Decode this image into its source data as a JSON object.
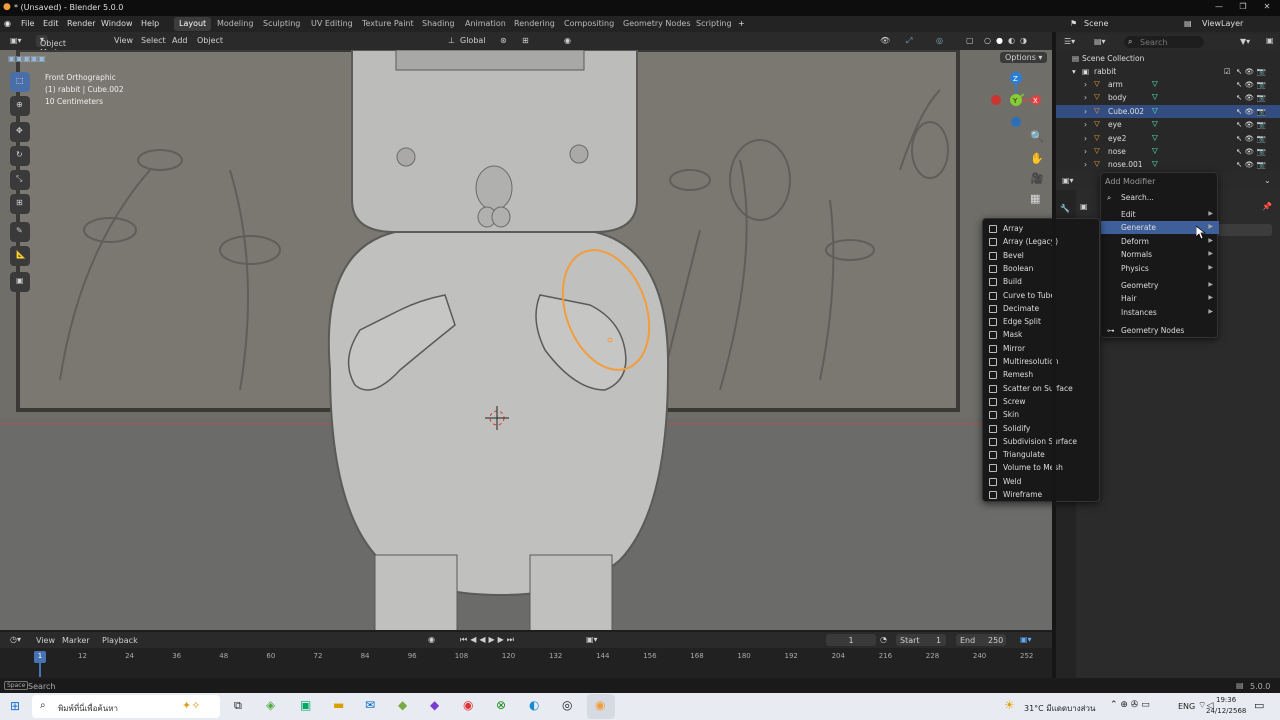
{
  "window": {
    "title": "* (Unsaved) - Blender 5.0.0"
  },
  "menubar": {
    "items": [
      "File",
      "Edit",
      "Render",
      "Window",
      "Help"
    ],
    "workspaces": [
      "Layout",
      "Modeling",
      "Sculpting",
      "UV Editing",
      "Texture Paint",
      "Shading",
      "Animation",
      "Rendering",
      "Compositing",
      "Geometry Nodes",
      "Scripting"
    ],
    "active_workspace": "Layout",
    "add_tab": "+",
    "scene_label": "Scene",
    "view_layer_label": "ViewLayer"
  },
  "viewport_header": {
    "mode": "Object Mode",
    "menus": [
      "View",
      "Select",
      "Add",
      "Object"
    ],
    "transform_orientation": "Global",
    "options": "Options"
  },
  "viewport_overlay": {
    "view_name": "Front Orthographic",
    "object_info": "(1) rabbit | Cube.002",
    "scale_info": "10 Centimeters"
  },
  "gizmo": {
    "x": "X",
    "y": "Y",
    "z": "Z"
  },
  "outliner": {
    "search_placeholder": "Search",
    "root": "Scene Collection",
    "collection": "rabbit",
    "objects": [
      "arm",
      "body",
      "Cube.002",
      "eye",
      "eye2",
      "nose",
      "nose.001"
    ],
    "selected": "Cube.002"
  },
  "add_modifier_menu": {
    "title": "Add Modifier",
    "search": "Search...",
    "categories": [
      "Edit",
      "Generate",
      "Deform",
      "Normals",
      "Physics"
    ],
    "categories2": [
      "Geometry",
      "Hair",
      "Instances"
    ],
    "geometry_nodes": "Geometry Nodes",
    "highlighted": "Generate"
  },
  "generate_submenu": {
    "items": [
      "Array",
      "Array (Legacy)",
      "Bevel",
      "Boolean",
      "Build",
      "Curve to Tube",
      "Decimate",
      "Edge Split",
      "Mask",
      "Mirror",
      "Multiresolution",
      "Remesh",
      "Scatter on Surface",
      "Screw",
      "Skin",
      "Solidify",
      "Subdivision Surface",
      "Triangulate",
      "Volume to Mesh",
      "Weld",
      "Wireframe"
    ]
  },
  "timeline": {
    "menus": [
      "View",
      "Marker",
      "Playback"
    ],
    "current_frame": "1",
    "start_label": "Start",
    "start": "1",
    "end_label": "End",
    "end": "250",
    "ticks": [
      "12",
      "24",
      "36",
      "48",
      "60",
      "72",
      "84",
      "96",
      "108",
      "120",
      "132",
      "144",
      "156",
      "168",
      "180",
      "192",
      "204",
      "216",
      "228",
      "240",
      "252"
    ],
    "playhead": "1"
  },
  "statusbar": {
    "key": "Space",
    "action": "Search",
    "version": "5.0.0"
  },
  "taskbar": {
    "search_placeholder": "พิมพ์ที่นี่เพื่อค้นหา",
    "weather": "31°C มีแดดบางส่วน",
    "lang": "ENG",
    "time": "19:36",
    "date": "24/12/2568"
  },
  "colors": {
    "accent": "#4772b3",
    "selection": "#f39c3c",
    "menu_bg": "#181818"
  }
}
